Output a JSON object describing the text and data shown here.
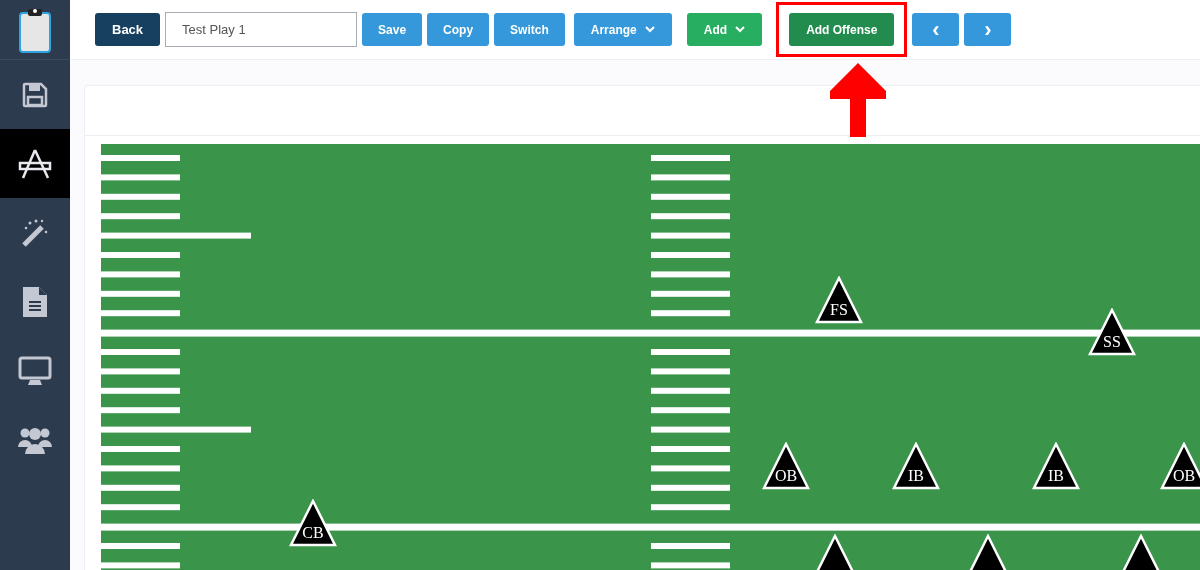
{
  "sidebar": {
    "items": [
      {
        "selected": false
      },
      {
        "selected": true
      },
      {
        "selected": false
      },
      {
        "selected": false
      },
      {
        "selected": false
      },
      {
        "selected": false
      }
    ]
  },
  "toolbar": {
    "back": "Back",
    "play_name": "Test Play 1",
    "buttons": [
      {
        "label": "Save",
        "kind": "blue"
      },
      {
        "label": "Copy",
        "kind": "blue"
      },
      {
        "label": "Switch",
        "kind": "blue"
      },
      {
        "label": "Arrange",
        "kind": "blue-dropdown"
      },
      {
        "label": "Add",
        "kind": "green-dropdown"
      },
      {
        "label": "Add Offense",
        "kind": "highlighted"
      },
      {
        "label": "‹",
        "kind": "nav"
      },
      {
        "label": "›",
        "kind": "nav"
      }
    ]
  },
  "field": {
    "players": [
      {
        "label": "FS"
      },
      {
        "label": "SS"
      },
      {
        "label": "OB"
      },
      {
        "label": "IB"
      },
      {
        "label": "IB"
      },
      {
        "label": "OB"
      },
      {
        "label": "CB"
      }
    ],
    "cut_off_markers": [
      {
        "kind": "triangle"
      },
      {
        "kind": "triangle"
      },
      {
        "kind": "triangle"
      }
    ]
  }
}
